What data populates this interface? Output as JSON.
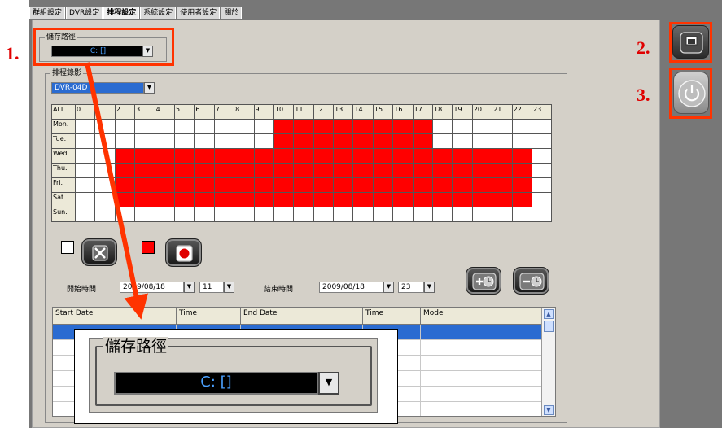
{
  "tabs": [
    "群組設定",
    "DVR設定",
    "排程設定",
    "系統設定",
    "使用者設定",
    "關於"
  ],
  "active_tab": 2,
  "storage_group": {
    "label": "儲存路徑",
    "value": "C: []"
  },
  "schedule_group": {
    "label": "排程錄影",
    "dvr_value": "DVR-04D"
  },
  "grid": {
    "all_label": "ALL",
    "hours": [
      "0",
      "1",
      "2",
      "3",
      "4",
      "5",
      "6",
      "7",
      "8",
      "9",
      "10",
      "11",
      "12",
      "13",
      "14",
      "15",
      "16",
      "17",
      "18",
      "19",
      "20",
      "21",
      "22",
      "23"
    ],
    "days": [
      "Mon.",
      "Tue.",
      "Wed",
      "Thu.",
      "Fri.",
      "Sat.",
      "Sun."
    ],
    "on_ranges": [
      [
        [
          10,
          17
        ]
      ],
      [
        [
          10,
          17
        ]
      ],
      [
        [
          2,
          22
        ]
      ],
      [
        [
          2,
          22
        ]
      ],
      [
        [
          2,
          22
        ]
      ],
      [
        [
          2,
          22
        ]
      ],
      []
    ]
  },
  "start": {
    "label": "開始時間",
    "date": "2009/08/18",
    "hour": "11"
  },
  "end": {
    "label": "結束時間",
    "date": "2009/08/18",
    "hour": "23"
  },
  "list": {
    "columns": [
      "Start Date",
      "Time",
      "End Date",
      "Time",
      "Mode"
    ]
  },
  "annotations": {
    "n1": "1.",
    "n2": "2.",
    "n3": "3."
  },
  "zoom": {
    "label": "儲存路徑",
    "value": "C: []"
  },
  "colors": {
    "record": "#ff0000",
    "highlight": "#ff3300",
    "arrow": "#ff3300"
  }
}
